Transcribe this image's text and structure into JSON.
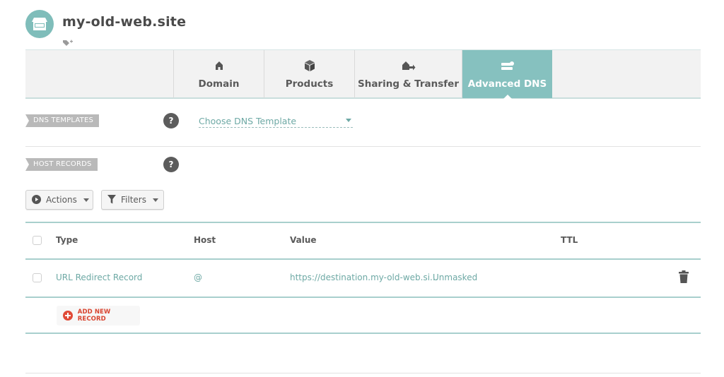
{
  "header": {
    "title": "my-old-web.site",
    "avatar_icon": "storefront-icon",
    "tag_icon": "add-tag-icon"
  },
  "tabs": [
    {
      "label": "Domain",
      "icon": "home-icon",
      "active": false
    },
    {
      "label": "Products",
      "icon": "box-icon",
      "active": false
    },
    {
      "label": "Sharing & Transfer",
      "icon": "home-transfer-icon",
      "active": false
    },
    {
      "label": "Advanced DNS",
      "icon": "server-icon",
      "active": true
    }
  ],
  "colors": {
    "accent": "#86c1bf",
    "link": "#6ea9a5",
    "danger": "#e04a37"
  },
  "dns_templates": {
    "label": "DNS TEMPLATES",
    "help": "?",
    "select_value": "Choose DNS Template"
  },
  "host_records": {
    "label": "HOST RECORDS",
    "help": "?",
    "actions_label": "Actions",
    "filters_label": "Filters",
    "columns": [
      "Type",
      "Host",
      "Value",
      "TTL"
    ],
    "rows": [
      {
        "type": "URL Redirect Record",
        "host": "@",
        "value": "https://destination.my-old-web.si...",
        "mode": "Unmasked",
        "ttl": ""
      }
    ],
    "add_label": "ADD NEW RECORD"
  }
}
